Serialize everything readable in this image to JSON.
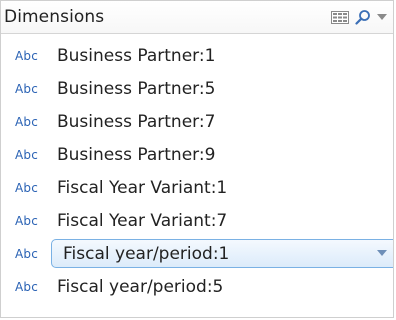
{
  "header": {
    "title": "Dimensions"
  },
  "items": [
    {
      "type": "Abc",
      "label": "Business Partner:1"
    },
    {
      "type": "Abc",
      "label": "Business Partner:5"
    },
    {
      "type": "Abc",
      "label": "Business Partner:7"
    },
    {
      "type": "Abc",
      "label": "Business Partner:9"
    },
    {
      "type": "Abc",
      "label": "Fiscal Year Variant:1"
    },
    {
      "type": "Abc",
      "label": "Fiscal Year Variant:7"
    },
    {
      "type": "Abc",
      "label": "Fiscal year/period:1"
    },
    {
      "type": "Abc",
      "label": "Fiscal year/period:5"
    }
  ],
  "colors": {
    "type_icon": "#2a62b4",
    "selection_border": "#7ab1e4",
    "selection_fill": "#dcebfa"
  },
  "icons": {
    "columns": "columns-icon",
    "search": "search-icon",
    "menu": "chevron-down-icon"
  }
}
